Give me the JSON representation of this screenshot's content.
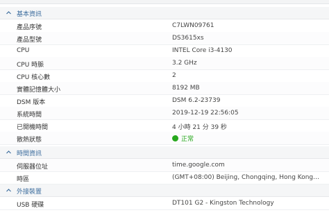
{
  "sections": [
    {
      "title": "基本資訊",
      "rows": [
        {
          "label": "產品序號",
          "value": "C7LWN09761"
        },
        {
          "label": "產品型號",
          "value": "DS3615xs"
        },
        {
          "label": "CPU",
          "value": "INTEL Core i3-4130"
        },
        {
          "label": "CPU 時脈",
          "value": "3.2 GHz"
        },
        {
          "label": "CPU 核心數",
          "value": "2"
        },
        {
          "label": "實體記憶體大小",
          "value": "8192 MB"
        },
        {
          "label": "DSM 版本",
          "value": "DSM 6.2-23739"
        },
        {
          "label": "系統時間",
          "value": "2019-12-19 22:56:05"
        },
        {
          "label": "已開機時間",
          "value": "4 小時 21 分 39 秒"
        },
        {
          "label": "散熱狀態",
          "value": "正常",
          "status_color": "#27a81d"
        }
      ]
    },
    {
      "title": "時間資訊",
      "rows": [
        {
          "label": "伺服器位址",
          "value": "time.google.com"
        },
        {
          "label": "時區",
          "value": "(GMT+08:00) Beijing, Chongqing, Hong Kong, Urum..."
        }
      ]
    },
    {
      "title": "外接裝置",
      "rows": [
        {
          "label": "USB 硬碟",
          "value": "DT101 G2 - Kingston Technology"
        }
      ]
    }
  ],
  "colors": {
    "section_title": "#3f6f9f",
    "status_ok": "#27a81d"
  },
  "icons": {
    "section_toggle": "chevron-up-icon",
    "status": "status-dot-icon"
  }
}
